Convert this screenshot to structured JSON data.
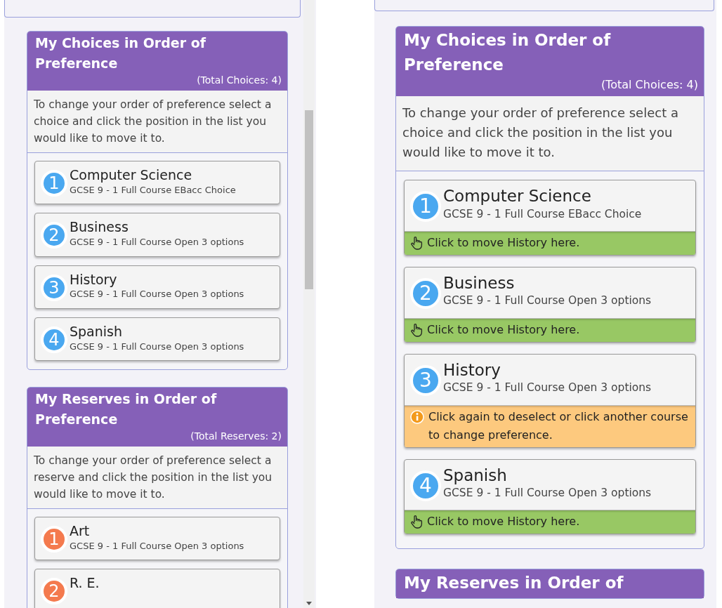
{
  "views": [
    {
      "sections": [
        {
          "kind": "choices",
          "title": "My Choices in Order of Preference",
          "total": "(Total Choices: 4)",
          "description": "To change your order of preference select a choice and click the position in the list you would like to move it to.",
          "items": [
            {
              "number": "1",
              "title": "Computer Science",
              "subtitle": "GCSE 9 - 1 Full Course EBacc Choice"
            },
            {
              "number": "2",
              "title": "Business",
              "subtitle": "GCSE 9 - 1 Full Course Open 3 options"
            },
            {
              "number": "3",
              "title": "History",
              "subtitle": "GCSE 9 - 1 Full Course Open 3 options"
            },
            {
              "number": "4",
              "title": "Spanish",
              "subtitle": "GCSE 9 - 1 Full Course Open 3 options"
            }
          ]
        },
        {
          "kind": "reserves",
          "title": "My Reserves in Order of Preference",
          "total": "(Total Reserves: 2)",
          "description": "To change your order of preference select a reserve and click the position in the list you would like to move it to.",
          "items": [
            {
              "number": "1",
              "title": "Art",
              "subtitle": "GCSE 9 - 1 Full Course Open 3 options"
            },
            {
              "number": "2",
              "title": "R. E."
            }
          ]
        }
      ]
    },
    {
      "sections": [
        {
          "kind": "choices",
          "title": "My Choices in Order of Preference",
          "total": "(Total Choices: 4)",
          "description": "To change your order of preference select a choice and click the position in the list you would like to move it to.",
          "items": [
            {
              "number": "1",
              "title": "Computer Science",
              "subtitle": "GCSE 9 - 1 Full Course EBacc Choice",
              "footer": {
                "kind": "move",
                "text": "Click to move History here."
              }
            },
            {
              "number": "2",
              "title": "Business",
              "subtitle": "GCSE 9 - 1 Full Course Open 3 options",
              "footer": {
                "kind": "move",
                "text": "Click to move History here."
              }
            },
            {
              "number": "3",
              "title": "History",
              "subtitle": "GCSE 9 - 1 Full Course Open 3 options",
              "footer": {
                "kind": "info",
                "text": "Click again to deselect or click another course to change preference."
              }
            },
            {
              "number": "4",
              "title": "Spanish",
              "subtitle": "GCSE 9 - 1 Full Course Open 3 options",
              "footer": {
                "kind": "move",
                "text": "Click to move History here."
              }
            }
          ]
        },
        {
          "title": "My Reserves in Order of"
        }
      ]
    }
  ]
}
